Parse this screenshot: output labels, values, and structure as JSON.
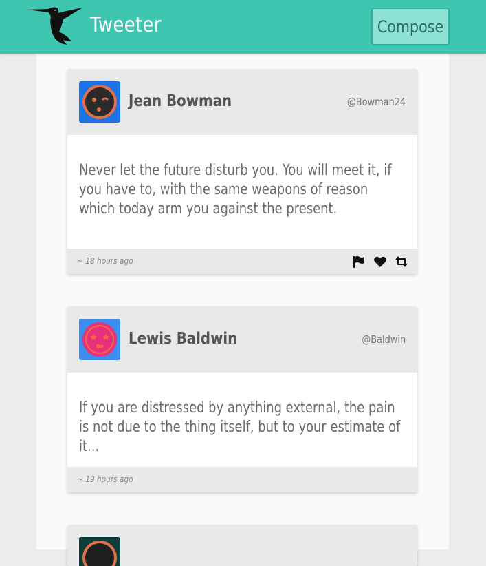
{
  "header": {
    "brand": "Tweeter",
    "compose_label": "Compose",
    "logo_icon": "hummingbird-icon",
    "color": "#3ec6b1"
  },
  "tweets": [
    {
      "name": "Jean Bowman",
      "handle": "@Bowman24",
      "text": "Never let the future disturb you. You will meet it, if you have to, with the same weapons of reason which today arm you against the present.",
      "time": "~ 18 hours ago",
      "avatar_colors": {
        "bg": "#1a73e8",
        "face": "#e0704a"
      },
      "actions": [
        "flag-icon",
        "heart-icon",
        "retweet-icon"
      ]
    },
    {
      "name": "Lewis Baldwin",
      "handle": "@Baldwin",
      "text": "If you are distressed by anything external, the pain is not due to the thing itself, but to your estimate of it...",
      "time": "~ 19 hours ago",
      "avatar_colors": {
        "bg": "#3b8ef0",
        "face": "#e8317a"
      }
    }
  ]
}
